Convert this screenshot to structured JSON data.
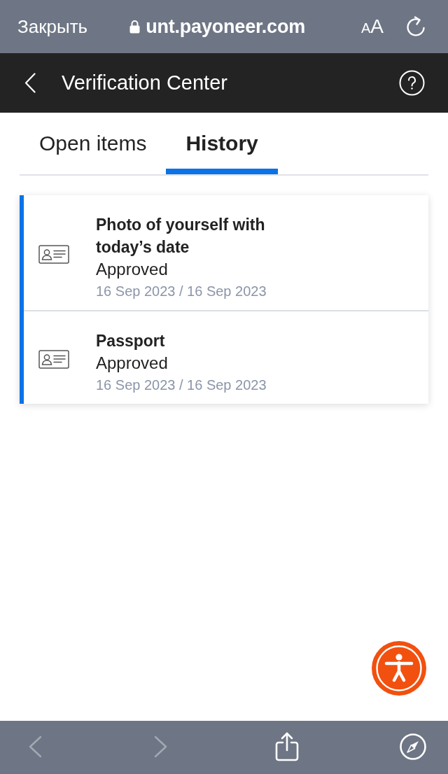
{
  "browser_bar": {
    "close_label": "Закрыть",
    "url": "unt.payoneer.com",
    "reader_label": "AA"
  },
  "header": {
    "title": "Verification Center"
  },
  "tabs": [
    {
      "label": "Open items",
      "selected": false
    },
    {
      "label": "History",
      "selected": true
    }
  ],
  "items": [
    {
      "title": "Photo of yourself with today’s date",
      "status": "Approved",
      "dates": "16 Sep 2023 / 16 Sep 2023"
    },
    {
      "title": "Passport",
      "status": "Approved",
      "dates": "16 Sep 2023 / 16 Sep 2023"
    }
  ],
  "toolbar": [
    {
      "kind": "back",
      "disabled": true
    },
    {
      "kind": "forward",
      "disabled": true
    },
    {
      "kind": "share",
      "disabled": false
    },
    {
      "kind": "compass",
      "disabled": false
    }
  ]
}
